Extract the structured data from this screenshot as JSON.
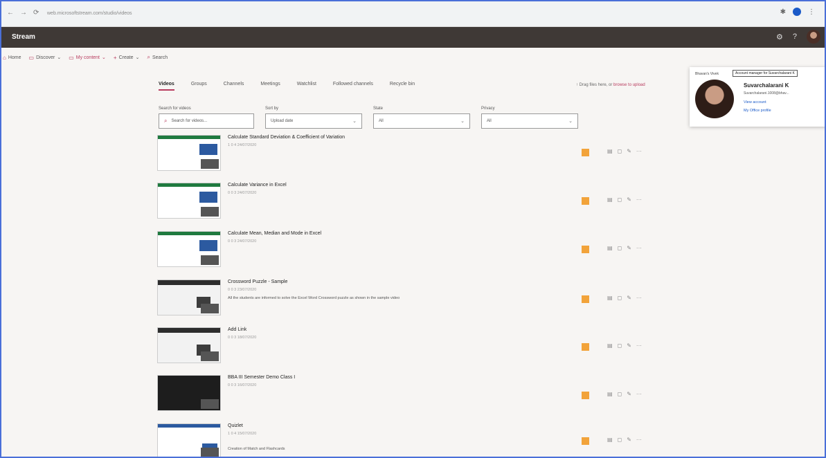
{
  "browser": {
    "url": "web.microsoftstream.com/studio/videos",
    "nav_back": "←",
    "nav_forward": "→",
    "reload": "⟳",
    "lock": "🔒",
    "ext_icon": "✱",
    "menu": "⋮"
  },
  "app": {
    "brand": "Stream",
    "settings_glyph": "⚙",
    "help_glyph": "?"
  },
  "subnav": {
    "home": "Home",
    "discover": "Discover",
    "my_content": "My content",
    "create": "Create",
    "search": "Search"
  },
  "tabs": [
    "Videos",
    "Groups",
    "Channels",
    "Meetings",
    "Watchlist",
    "Followed channels",
    "Recycle bin"
  ],
  "upload": {
    "prefix": "Drag files here, or",
    "link": "browse to upload"
  },
  "filters": {
    "search": {
      "label": "Search for videos",
      "placeholder": "Search for videos..."
    },
    "sort": {
      "label": "Sort by",
      "value": "Upload date"
    },
    "state": {
      "label": "State",
      "value": "All"
    },
    "privacy": {
      "label": "Privacy",
      "value": "All"
    }
  },
  "videos": [
    {
      "title": "Calculate Standard Deviation & Coefficient of Variation",
      "meta": "1  0  4  24/07/2020",
      "desc": "",
      "thumb": "excel"
    },
    {
      "title": "Calculate Variance in Excel",
      "meta": "0  0  3  24/07/2020",
      "desc": "",
      "thumb": "excel"
    },
    {
      "title": "Calculate Mean, Median and Mode in Excel",
      "meta": "0  0  3  24/07/2020",
      "desc": "",
      "thumb": "excel"
    },
    {
      "title": "Crossword Puzzle - Sample",
      "meta": "0  0  3  23/07/2020",
      "desc": "All the students are informed to solve the Excel Word Crossword puzzle as shown in the sample video",
      "thumb": "screen"
    },
    {
      "title": "Add Link",
      "meta": "0  0  3  18/07/2020",
      "desc": "",
      "thumb": "screen"
    },
    {
      "title": "BBA III Semester Demo Class I",
      "meta": "0  0  3  16/07/2020",
      "desc": "",
      "thumb": "dark"
    },
    {
      "title": "Quizlet",
      "meta": "1  0  4  15/07/2020",
      "desc": "Creation of Match and Flashcards",
      "thumb": "quiz"
    }
  ],
  "profile": {
    "org": "Bhavan's Vivek",
    "tooltip": "Account manager for Suvarchalarani K",
    "name": "Suvarchalarani K",
    "email": "Suvarchalarani.1008@bhav...",
    "view_account": "View account",
    "office_profile": "My Office profile"
  },
  "icons": {
    "search": "⌕",
    "chevron": "⌄",
    "upload": "↑",
    "more": "···",
    "edit": "✎",
    "share": "◻",
    "stats": "▤"
  }
}
